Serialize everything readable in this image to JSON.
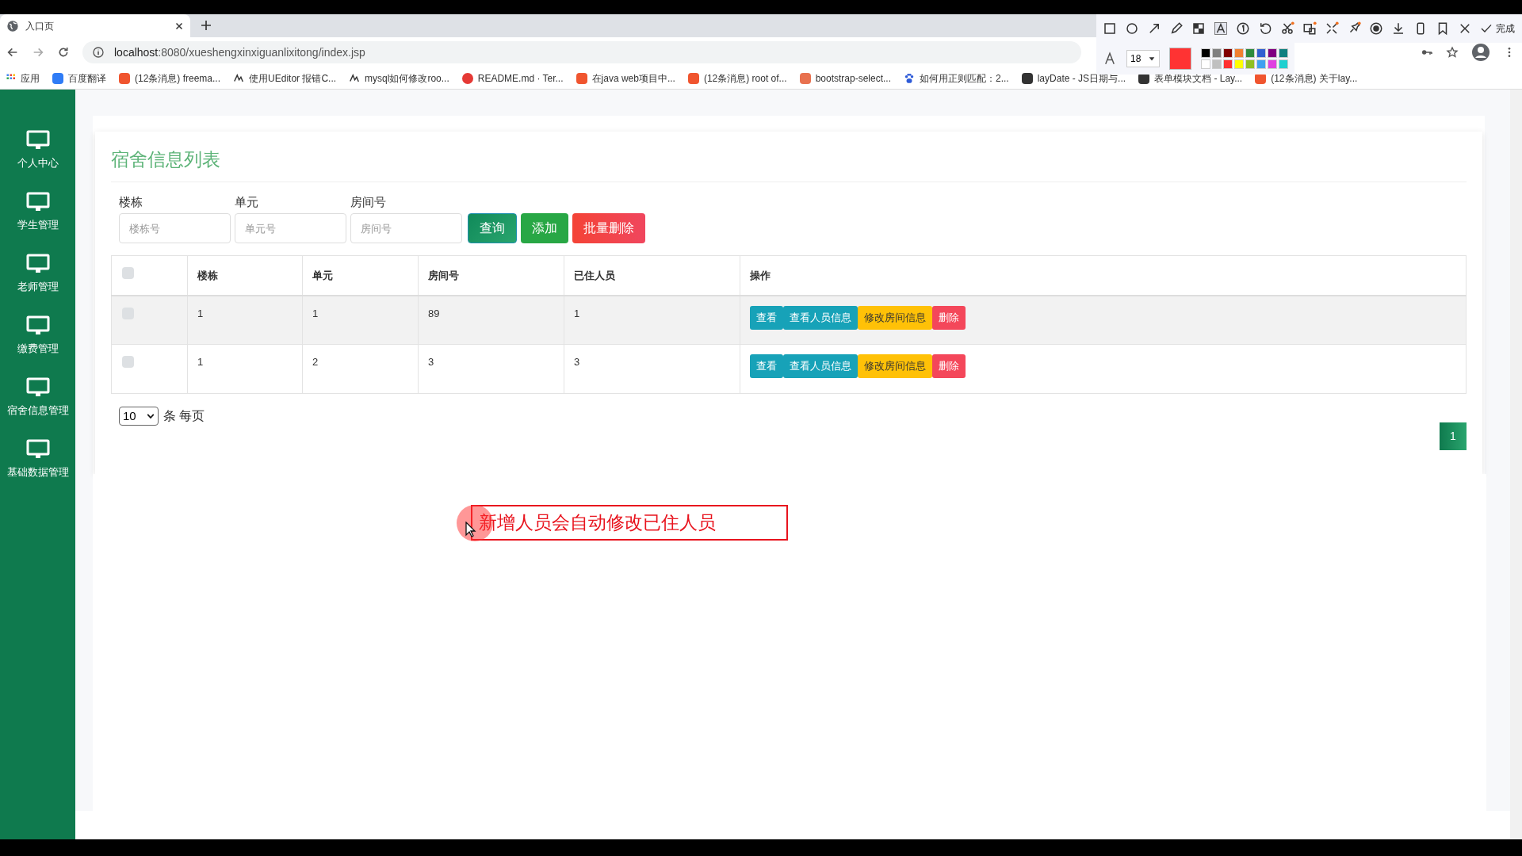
{
  "browser": {
    "tab_title": "入口页",
    "url_host": "localhost",
    "url_rest": ":8080/xueshengxinxiguanlixitong/index.jsp",
    "bookmarks": [
      {
        "label": "应用",
        "kind": "apps"
      },
      {
        "label": "百度翻译",
        "kind": "square",
        "color": "#2f7cf6"
      },
      {
        "label": "(12条消息) freema...",
        "kind": "square",
        "color": "#f0552f"
      },
      {
        "label": "使用UEditor 报错C...",
        "kind": "glyph"
      },
      {
        "label": "mysql如何修改roo...",
        "kind": "glyph"
      },
      {
        "label": "README.md · Ter...",
        "kind": "circle",
        "color": "#e53935"
      },
      {
        "label": "在java web项目中...",
        "kind": "square",
        "color": "#f0552f"
      },
      {
        "label": "(12条消息) root of...",
        "kind": "square",
        "color": "#f0552f"
      },
      {
        "label": "bootstrap-select...",
        "kind": "square",
        "color": "#e8714f"
      },
      {
        "label": "如何用正则匹配：2...",
        "kind": "paw"
      },
      {
        "label": "layDate - JS日期与...",
        "kind": "square",
        "color": "#333333"
      },
      {
        "label": "表单模块文档 - Lay...",
        "kind": "square",
        "color": "#333333"
      },
      {
        "label": "(12条消息) 关于lay...",
        "kind": "square",
        "color": "#f0552f"
      }
    ]
  },
  "capture_toolbar": {
    "font_size": "18",
    "done": "完成",
    "swatches": [
      {
        "color": "#000000"
      },
      {
        "color": "#808080"
      },
      {
        "color": "#800000"
      },
      {
        "color": "#f08030"
      },
      {
        "color": "#2e8b3e"
      },
      {
        "color": "#3060d0"
      },
      {
        "color": "#800080"
      },
      {
        "color": "#108080"
      },
      {
        "color": "#ffffff"
      },
      {
        "color": "#c0c0c0"
      },
      {
        "color": "#ff3030"
      },
      {
        "color": "#ffff00"
      },
      {
        "color": "#90c020"
      },
      {
        "color": "#40a0f0"
      },
      {
        "color": "#e040e0"
      },
      {
        "color": "#20d0d0"
      }
    ]
  },
  "sidebar": {
    "items": [
      {
        "label": "个人中心"
      },
      {
        "label": "学生管理"
      },
      {
        "label": "老师管理"
      },
      {
        "label": "缴费管理"
      },
      {
        "label": "宿舍信息管理"
      },
      {
        "label": "基础数据管理"
      }
    ]
  },
  "panel": {
    "title": "宿舍信息列表",
    "filters": [
      {
        "label": "楼栋",
        "placeholder": "楼栋号"
      },
      {
        "label": "单元",
        "placeholder": "单元号"
      },
      {
        "label": "房间号",
        "placeholder": "房间号"
      }
    ],
    "buttons": [
      {
        "label": "查询",
        "kind": "query"
      },
      {
        "label": "添加",
        "kind": "add"
      },
      {
        "label": "批量删除",
        "kind": "danger"
      }
    ],
    "table": {
      "columns": [
        "楼栋",
        "单元",
        "房间号",
        "已住人员",
        "操作"
      ],
      "header_checked": false,
      "rows": [
        {
          "checked": false,
          "cells": [
            "1",
            "1",
            "89",
            "1"
          ],
          "actions": [
            {
              "label": "查看",
              "kind": "info"
            },
            {
              "label": "查看人员信息",
              "kind": "info"
            },
            {
              "label": "修改房间信息",
              "kind": "warning"
            },
            {
              "label": "删除",
              "kind": "danger"
            }
          ]
        },
        {
          "checked": false,
          "cells": [
            "1",
            "2",
            "3",
            "3"
          ],
          "actions": [
            {
              "label": "查看",
              "kind": "info"
            },
            {
              "label": "查看人员信息",
              "kind": "info"
            },
            {
              "label": "修改房间信息",
              "kind": "warning"
            },
            {
              "label": "删除",
              "kind": "danger"
            }
          ]
        }
      ]
    },
    "page_size": "10",
    "page_size_suffix": "条 每页",
    "pages": [
      {
        "label": "1",
        "selected": true
      }
    ]
  },
  "annotation": {
    "text": "新增人员会自动修改已住人员"
  }
}
